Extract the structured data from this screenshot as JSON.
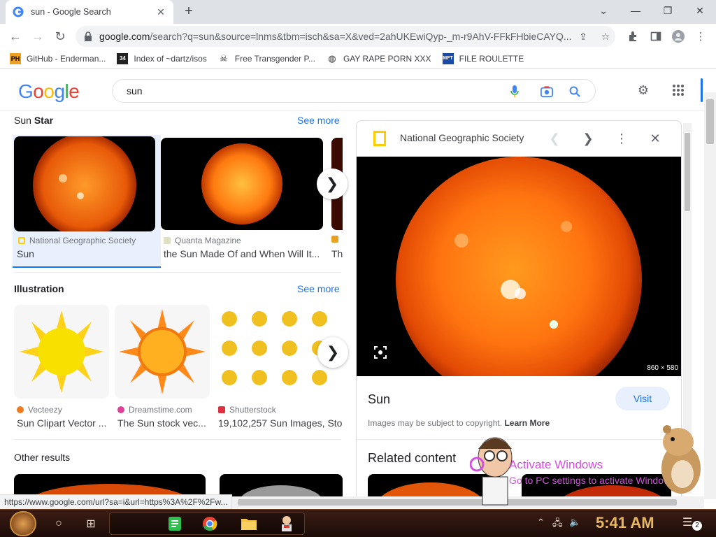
{
  "browser": {
    "tab_title": "sun - Google Search",
    "tab_close": "✕",
    "new_tab": "+",
    "url_host": "google.com",
    "url_rest": "/search?q=sun&source=lnms&tbm=isch&sa=X&ved=2ahUKEwiQyp-_m-r9AhV-FFkFHbieCAYQ...",
    "status_url": "https://www.google.com/url?sa=i&url=https%3A%2F%2Fw..."
  },
  "bookmarks": [
    {
      "label": "GitHub - Enderman...",
      "icon": "PH"
    },
    {
      "label": "Index of ~dartz/isos",
      "icon": "34"
    },
    {
      "label": "Free Transgender P...",
      "icon": "skull"
    },
    {
      "label": "GAY RAPE PORN XXX",
      "icon": "globe"
    },
    {
      "label": "FILE ROULETTE",
      "icon": "MFT"
    }
  ],
  "google": {
    "logo": [
      "G",
      "o",
      "o",
      "g",
      "l",
      "e"
    ],
    "query": "sun"
  },
  "sections": {
    "sun_star": {
      "title_pre": "Sun ",
      "title_bold": "Star",
      "see_more": "See more"
    },
    "illustration": {
      "title": "Illustration",
      "see_more": "See more"
    },
    "other": {
      "title": "Other results"
    }
  },
  "star_results": [
    {
      "source": "National Geographic Society",
      "caption": "Sun"
    },
    {
      "source": "Quanta Magazine",
      "caption": "the Sun Made Of and When Will It..."
    },
    {
      "source": "",
      "caption": "Th"
    }
  ],
  "illustration_results": [
    {
      "source": "Vecteezy",
      "caption": "Sun Clipart Vector ..."
    },
    {
      "source": "Dreamstime.com",
      "caption": "The Sun stock vec..."
    },
    {
      "source": "Shutterstock",
      "caption": "19,102,257 Sun Images, Sto"
    }
  ],
  "panel": {
    "source": "National Geographic Society",
    "dimensions": "860 × 580",
    "title": "Sun",
    "visit": "Visit",
    "copyright": "Images may be subject to copyright.",
    "learn_more": "Learn More",
    "related": "Related content"
  },
  "overlay": {
    "activate_title": "Activate Windows",
    "activate_sub": "Go to PC settings to activate Windows."
  },
  "taskbar": {
    "clock": "5:41 AM",
    "notifications": "2"
  },
  "colors": {
    "accent": "#1a73e8",
    "link": "#1a73e8",
    "sun_orange": "#ff7a1a"
  }
}
